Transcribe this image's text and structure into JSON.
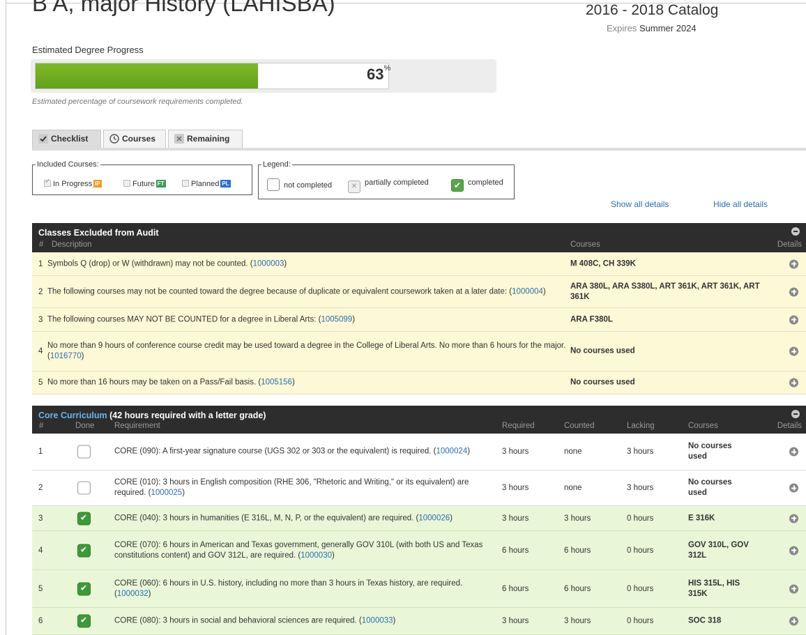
{
  "header": {
    "title": "B A, major History (LAHISBA)",
    "catalog": "2016 - 2018 Catalog",
    "expires_label": "Expires",
    "expires_value": "Summer 2024"
  },
  "progress": {
    "label": "Estimated Degree Progress",
    "percent": 63,
    "percent_text": "63",
    "percent_sign": "%",
    "note": "Estimated percentage of coursework requirements completed.",
    "fill_color": "#6aab1f"
  },
  "tabs": [
    {
      "label": "Checklist",
      "icon": "check-icon",
      "active": true
    },
    {
      "label": "Courses",
      "icon": "clock-icon",
      "active": false
    },
    {
      "label": "Remaining",
      "icon": "x-icon",
      "active": false
    }
  ],
  "included": {
    "legend": "Included Courses:",
    "items": [
      {
        "label": "In Progress",
        "badge": "IP",
        "badge_color": "#f29a1f",
        "checked": true
      },
      {
        "label": "Future",
        "badge": "FT",
        "badge_color": "#3b9b5b",
        "checked": false
      },
      {
        "label": "Planned",
        "badge": "PL",
        "badge_color": "#2b6fd6",
        "checked": false
      }
    ]
  },
  "legend": {
    "legend": "Legend:",
    "items": [
      {
        "label": "not completed",
        "state": "none"
      },
      {
        "label": "partially completed",
        "state": "partial"
      },
      {
        "label": "completed",
        "state": "done"
      }
    ]
  },
  "details_links": {
    "show": "Show all details",
    "hide": "Hide all details"
  },
  "excluded": {
    "title": "Classes Excluded from Audit",
    "columns": {
      "num": "#",
      "desc": "Description",
      "courses": "Courses",
      "details": "Details"
    },
    "rows": [
      {
        "num": "1",
        "text": "Symbols Q (drop) or W (withdrawn) may not be counted. (",
        "code": "1000003",
        "tail": ")",
        "courses": "M 408C, CH 339K"
      },
      {
        "num": "2",
        "text": "The following courses may not be counted toward the degree because of duplicate or equivalent coursework taken at a later date: (",
        "code": "1000004",
        "tail": ")",
        "courses": "ARA 380L, ARA S380L, ART 361K, ART 361K, ART 361K"
      },
      {
        "num": "3",
        "text": "The following courses MAY NOT BE COUNTED for a degree in Liberal Arts: (",
        "code": "1005099",
        "tail": ")",
        "courses": "ARA F380L"
      },
      {
        "num": "4",
        "text": "No more than 9 hours of conference course credit may be used toward a degree in the College of Liberal Arts. No more than 6 hours for the major. (",
        "code": "1016770",
        "tail": ")",
        "courses": "No courses used"
      },
      {
        "num": "5",
        "text": "No more than 16 hours may be taken on a Pass/Fail basis. (",
        "code": "1005156",
        "tail": ")",
        "courses": "No courses used"
      }
    ]
  },
  "core": {
    "title_link": "Core Curriculum",
    "title_rest": " (42 hours required with a letter grade)",
    "columns": {
      "num": "#",
      "done": "Done",
      "req": "Requirement",
      "required": "Required",
      "counted": "Counted",
      "lacking": "Lacking",
      "courses": "Courses",
      "details": "Details"
    },
    "rows": [
      {
        "num": "1",
        "done": false,
        "text": "CORE (090): A first-year signature course (UGS 302 or 303 or the equivalent) is required. (",
        "code": "1000024",
        "tail": ")",
        "required": "3 hours",
        "counted": "none",
        "lacking": "3 hours",
        "courses": "No courses used"
      },
      {
        "num": "2",
        "done": false,
        "text": "CORE (010): 3 hours in English composition (RHE 306, \"Rhetoric and Writing,\" or its equivalent) are required. (",
        "code": "1000025",
        "tail": ")",
        "required": "3 hours",
        "counted": "none",
        "lacking": "3 hours",
        "courses": "No courses used"
      },
      {
        "num": "3",
        "done": true,
        "text": "CORE (040): 3 hours in humanities (E 316L, M, N, P, or the equivalent) are required. (",
        "code": "1000026",
        "tail": ")",
        "required": "3 hours",
        "counted": "3 hours",
        "lacking": "0 hours",
        "courses": "E 316K"
      },
      {
        "num": "4",
        "done": true,
        "text": "CORE (070): 6 hours in American and Texas government, generally GOV 310L (with both US and Texas constitutions content) and GOV 312L, are required. (",
        "code": "1000030",
        "tail": ")",
        "required": "6 hours",
        "counted": "6 hours",
        "lacking": "0 hours",
        "courses": "GOV 310L, GOV 312L"
      },
      {
        "num": "5",
        "done": true,
        "text": "CORE (060): 6 hours in U.S. history, including no more than 3 hours in Texas history, are required. (",
        "code": "1000032",
        "tail": ")",
        "required": "6 hours",
        "counted": "6 hours",
        "lacking": "0 hours",
        "courses": "HIS 315L, HIS 315K"
      },
      {
        "num": "6",
        "done": true,
        "text": "CORE (080): 3 hours in social and behavioral sciences are required. (",
        "code": "1000033",
        "tail": ")",
        "required": "3 hours",
        "counted": "3 hours",
        "lacking": "0 hours",
        "courses": "SOC 318"
      }
    ]
  }
}
